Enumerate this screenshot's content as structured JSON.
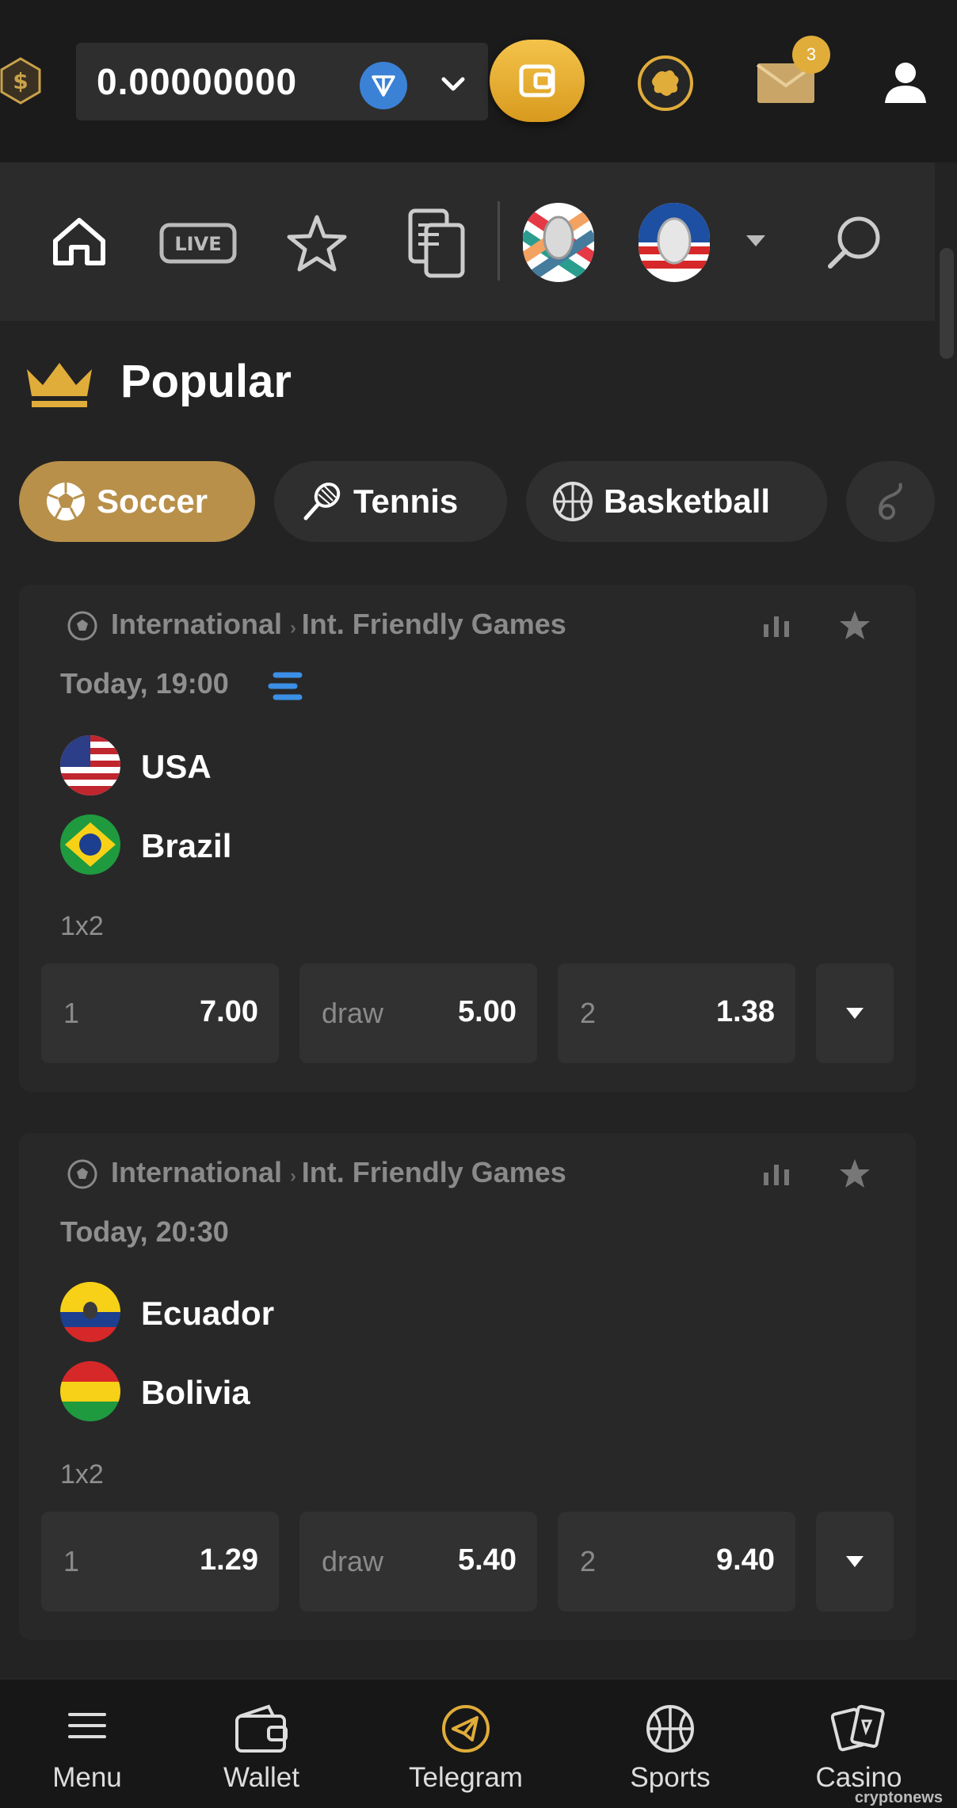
{
  "header": {
    "balance": "0.00000000",
    "currency_icon": "ton-coin-icon",
    "mail_badge_count": "3",
    "accent_color": "#e0ac3a"
  },
  "subnav": {
    "live_label": "LIVE"
  },
  "popular": {
    "title": "Popular",
    "chips": [
      {
        "label": "Soccer",
        "icon": "soccer-ball-icon",
        "active": true
      },
      {
        "label": "Tennis",
        "icon": "tennis-racket-icon",
        "active": false
      },
      {
        "label": "Basketball",
        "icon": "basketball-icon",
        "active": false
      }
    ]
  },
  "matches": [
    {
      "country": "International",
      "league": "Int. Friendly Games",
      "time": "Today, 19:00",
      "home": "USA",
      "away": "Brazil",
      "market": "1x2",
      "odds": [
        {
          "label": "1",
          "value": "7.00"
        },
        {
          "label": "draw",
          "value": "5.00"
        },
        {
          "label": "2",
          "value": "1.38"
        }
      ]
    },
    {
      "country": "International",
      "league": "Int. Friendly Games",
      "time": "Today, 20:30",
      "home": "Ecuador",
      "away": "Bolivia",
      "market": "1x2",
      "odds": [
        {
          "label": "1",
          "value": "1.29"
        },
        {
          "label": "draw",
          "value": "5.40"
        },
        {
          "label": "2",
          "value": "9.40"
        }
      ]
    }
  ],
  "bottom_nav": [
    {
      "label": "Menu",
      "icon": "hamburger-icon"
    },
    {
      "label": "Wallet",
      "icon": "wallet-icon"
    },
    {
      "label": "Telegram",
      "icon": "telegram-icon"
    },
    {
      "label": "Sports",
      "icon": "basketball-icon"
    },
    {
      "label": "Casino",
      "icon": "cards-icon"
    }
  ],
  "watermark": "cryptonews"
}
